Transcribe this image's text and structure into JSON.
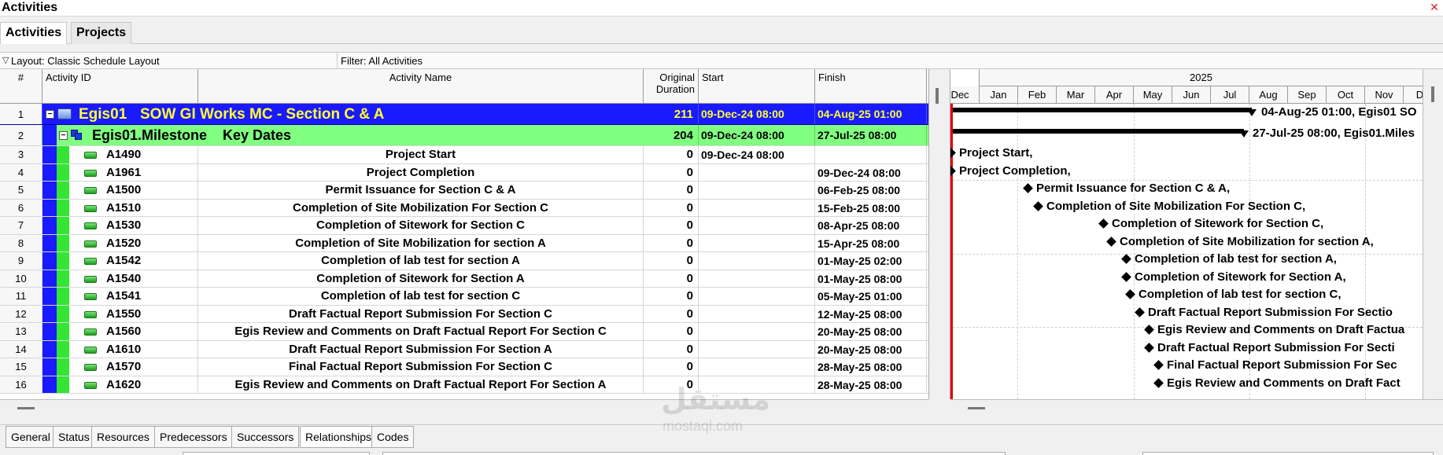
{
  "window": {
    "title": "Activities"
  },
  "tabs": [
    "Activities",
    "Projects"
  ],
  "layout": {
    "label": "Layout: Classic Schedule Layout",
    "filter": "Filter: All Activities"
  },
  "columns": {
    "num": "#",
    "id": "Activity ID",
    "name": "Activity Name",
    "duration": "Original Duration",
    "start": "Start",
    "finish": "Finish"
  },
  "wbs": [
    {
      "num": "1",
      "id": "Egis01",
      "name": "SOW GI Works MC - Section C & A",
      "duration": "211",
      "start": "09-Dec-24 08:00",
      "finish": "04-Aug-25 01:00"
    },
    {
      "num": "2",
      "id": "Egis01.Milestone",
      "name": "Key Dates",
      "duration": "204",
      "start": "09-Dec-24 08:00",
      "finish": "27-Jul-25 08:00"
    }
  ],
  "activities": [
    {
      "num": "3",
      "id": "A1490",
      "name": "Project Start",
      "duration": "0",
      "start": "09-Dec-24 08:00",
      "finish": ""
    },
    {
      "num": "4",
      "id": "A1961",
      "name": "Project Completion",
      "duration": "0",
      "start": "",
      "finish": "09-Dec-24 08:00"
    },
    {
      "num": "5",
      "id": "A1500",
      "name": "Permit Issuance for Section C & A",
      "duration": "0",
      "start": "",
      "finish": "06-Feb-25 08:00"
    },
    {
      "num": "6",
      "id": "A1510",
      "name": "Completion of Site Mobilization For Section C",
      "duration": "0",
      "start": "",
      "finish": "15-Feb-25 08:00"
    },
    {
      "num": "7",
      "id": "A1530",
      "name": "Completion of Sitework for Section C",
      "duration": "0",
      "start": "",
      "finish": "08-Apr-25 08:00"
    },
    {
      "num": "8",
      "id": "A1520",
      "name": "Completion of Site Mobilization for section A",
      "duration": "0",
      "start": "",
      "finish": "15-Apr-25 08:00"
    },
    {
      "num": "9",
      "id": "A1542",
      "name": "Completion of lab test for section A",
      "duration": "0",
      "start": "",
      "finish": "01-May-25 02:00"
    },
    {
      "num": "10",
      "id": "A1540",
      "name": "Completion of Sitework for Section A",
      "duration": "0",
      "start": "",
      "finish": "01-May-25 08:00"
    },
    {
      "num": "11",
      "id": "A1541",
      "name": "Completion of lab test for section C",
      "duration": "0",
      "start": "",
      "finish": "05-May-25 01:00"
    },
    {
      "num": "12",
      "id": "A1550",
      "name": "Draft Factual    Report Submission For Section C",
      "duration": "0",
      "start": "",
      "finish": "12-May-25 08:00"
    },
    {
      "num": "13",
      "id": "A1560",
      "name": "Egis Review and Comments on Draft Factual    Report For Section C",
      "duration": "0",
      "start": "",
      "finish": "20-May-25 08:00"
    },
    {
      "num": "14",
      "id": "A1610",
      "name": "Draft Factual    Report Submission For Section A",
      "duration": "0",
      "start": "",
      "finish": "20-May-25 08:00"
    },
    {
      "num": "15",
      "id": "A1570",
      "name": "Final Factual    Report Submission For Section C",
      "duration": "0",
      "start": "",
      "finish": "28-May-25 08:00"
    },
    {
      "num": "16",
      "id": "A1620",
      "name": "Egis Review and Comments on Draft Factual    Report For Section A",
      "duration": "0",
      "start": "",
      "finish": "28-May-25 08:00"
    }
  ],
  "gantt": {
    "year": "2025",
    "months": [
      "Dec",
      "Jan",
      "Feb",
      "Mar",
      "Apr",
      "May",
      "Jun",
      "Jul",
      "Aug",
      "Sep",
      "Oct",
      "Nov",
      "De"
    ],
    "wbs_labels": [
      "04-Aug-25 01:00, Egis01  SO",
      "27-Jul-25 08:00, Egis01.Miles"
    ],
    "labels": [
      "Project Start,",
      "Project Completion,",
      "Permit Issuance for Section C & A,",
      "Completion of Site Mobilization For Section C,",
      "Completion of Sitework for Section C,",
      "Completion of Site Mobilization for section A,",
      "Completion of lab test for section A,",
      "Completion of Sitework for Section A,",
      "Completion of lab test for section C,",
      "Draft Factual    Report Submission For Sectio",
      "Egis Review and Comments on Draft Factua",
      "Draft Factual    Report Submission For Secti",
      "Final Factual    Report Submission For Sec",
      "Egis Review and Comments on Draft Fact"
    ]
  },
  "bottom_tabs": [
    "General",
    "Status",
    "Resources",
    "Predecessors",
    "Successors",
    "Relationships",
    "Codes"
  ],
  "watermark": {
    "arabic": "مستقل",
    "latin": "mostaql.com"
  }
}
